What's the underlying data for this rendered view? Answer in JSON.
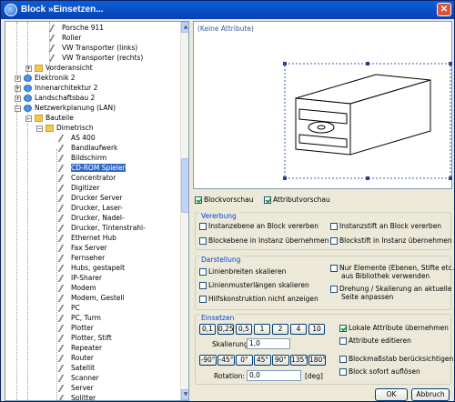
{
  "window": {
    "title": "Block »Einsetzen...",
    "close_icon": "close-icon"
  },
  "tree": {
    "items": [
      {
        "label": "Porsche 911",
        "icon": "pen"
      },
      {
        "label": "Roller",
        "icon": "pen"
      },
      {
        "label": "VW Transporter (links)",
        "icon": "pen"
      },
      {
        "label": "VW Transporter (rechts)",
        "icon": "pen"
      },
      {
        "label": "Vorderansicht",
        "icon": "folder"
      },
      {
        "label": "Elektronik 2",
        "icon": "globe"
      },
      {
        "label": "Innenarchitektur 2",
        "icon": "globe"
      },
      {
        "label": "Landschaftsbau 2",
        "icon": "globe"
      },
      {
        "label": "Netzwerkplanung (LAN)",
        "icon": "globe"
      },
      {
        "label": "Bauteile",
        "icon": "folder"
      },
      {
        "label": "Dimetrisch",
        "icon": "folder"
      },
      {
        "label": "AS 400",
        "icon": "pen"
      },
      {
        "label": "Bandlaufwerk",
        "icon": "pen"
      },
      {
        "label": "Bildschirm",
        "icon": "pen"
      },
      {
        "label": "CD-ROM Spieler",
        "icon": "pen",
        "selected": true
      },
      {
        "label": "Concentrator",
        "icon": "pen"
      },
      {
        "label": "Digitizer",
        "icon": "pen"
      },
      {
        "label": "Drucker Server",
        "icon": "pen"
      },
      {
        "label": "Drucker, Laser-",
        "icon": "pen"
      },
      {
        "label": "Drucker, Nadel-",
        "icon": "pen"
      },
      {
        "label": "Drucker, Tintenstrahl-",
        "icon": "pen"
      },
      {
        "label": "Ethernet Hub",
        "icon": "pen"
      },
      {
        "label": "Fax Server",
        "icon": "pen"
      },
      {
        "label": "Fernseher",
        "icon": "pen"
      },
      {
        "label": "Hubs, gestapelt",
        "icon": "pen"
      },
      {
        "label": "IP-Sharer",
        "icon": "pen"
      },
      {
        "label": "Modem",
        "icon": "pen"
      },
      {
        "label": "Modem, Gestell",
        "icon": "pen"
      },
      {
        "label": "PC",
        "icon": "pen"
      },
      {
        "label": "PC, Turm",
        "icon": "pen"
      },
      {
        "label": "Plotter",
        "icon": "pen"
      },
      {
        "label": "Plotter, Stift",
        "icon": "pen"
      },
      {
        "label": "Repeater",
        "icon": "pen"
      },
      {
        "label": "Router",
        "icon": "pen"
      },
      {
        "label": "Satellit",
        "icon": "pen"
      },
      {
        "label": "Scanner",
        "icon": "pen"
      },
      {
        "label": "Server",
        "icon": "pen"
      },
      {
        "label": "Splitter",
        "icon": "pen"
      }
    ]
  },
  "preview": {
    "no_attributes": "(Keine Attribute)"
  },
  "checks": {
    "blockvorschau": "Blockvorschau",
    "attributvorschau": "Attributvorschau"
  },
  "verbung": {
    "title": "Vererbung",
    "instanzebene": "Instanzebene an Block vererben",
    "instanzstift": "Instanzstift an Block vererben",
    "blockebene": "Blockebene in Instanz übernehmen",
    "blockstift": "Blockstift in Instanz übernehmen"
  },
  "darstellung": {
    "title": "Darstellung",
    "linienbreiten": "Linienbreiten skalieren",
    "linienmuster": "Linienmusterlängen skalieren",
    "hilfskonstruktion": "Hilfskonstruktion nicht anzeigen",
    "nur_elemente_1": "Nur Elemente (Ebenen, Stifte etc.)",
    "nur_elemente_2": "aus Bibliothek verwenden",
    "drehung_1": "Drehung / Skalierung an aktuelle",
    "drehung_2": "Seite anpassen"
  },
  "einsetzen": {
    "title": "Einsetzen",
    "scale_buttons": [
      "0,1",
      "0,25",
      "0,5",
      "1",
      "2",
      "4",
      "10"
    ],
    "skalierung_label": "Skalierung:",
    "skalierung_value": "1,0",
    "angle_buttons": [
      "-90°",
      "-45°",
      "0°",
      "45°",
      "90°",
      "135°",
      "180°"
    ],
    "rotation_label": "Rotation:",
    "rotation_value": "0,0",
    "deg": "[deg]",
    "lokale_attr": "Lokale Attribute übernehmen",
    "attr_editieren": "Attribute editieren",
    "blockmassstab": "Blockmaßstab berücksichtigen",
    "block_aufloesen": "Block sofort auflösen"
  },
  "buttons": {
    "ok": "OK",
    "abbruch": "Abbruch"
  }
}
